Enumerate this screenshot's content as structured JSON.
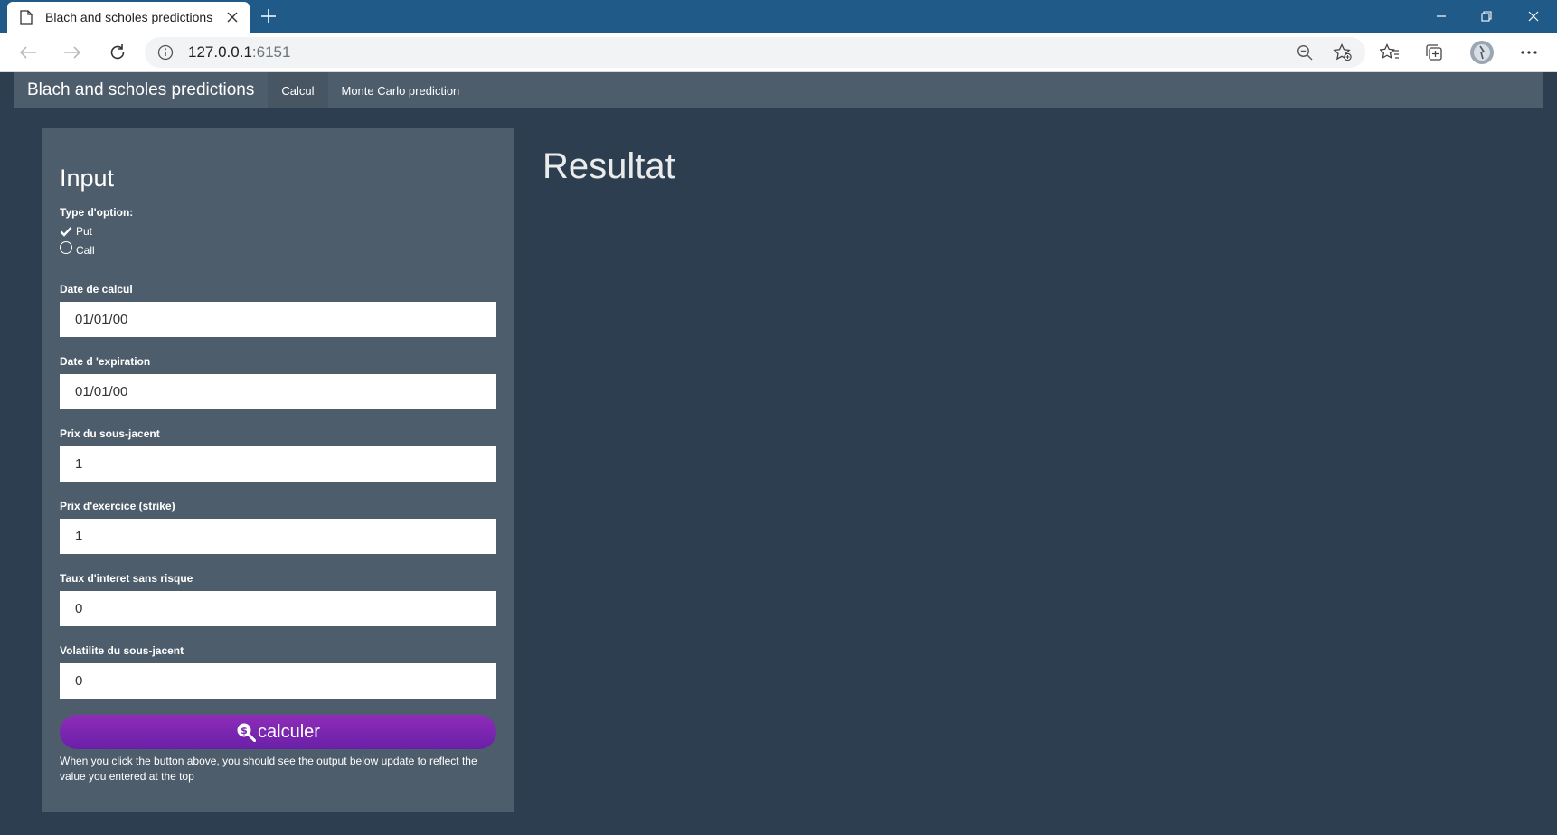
{
  "browser": {
    "tab_title": "Blach and scholes predictions",
    "url_host": "127.0.0.1",
    "url_port": ":6151"
  },
  "navbar": {
    "brand": "Blach and scholes predictions",
    "tabs": [
      {
        "label": "Calcul",
        "active": true
      },
      {
        "label": "Monte Carlo prediction",
        "active": false
      }
    ]
  },
  "sidebar": {
    "title": "Input",
    "option_type": {
      "label": "Type d'option:",
      "options": [
        {
          "label": "Put",
          "selected": true
        },
        {
          "label": "Call",
          "selected": false
        }
      ]
    },
    "fields": [
      {
        "label": "Date de calcul",
        "value": "01/01/00"
      },
      {
        "label": "Date d 'expiration",
        "value": "01/01/00"
      },
      {
        "label": "Prix du sous-jacent",
        "value": "1"
      },
      {
        "label": "Prix d'exercice (strike)",
        "value": "1"
      },
      {
        "label": "Taux d'interet sans risque",
        "value": "0"
      },
      {
        "label": "Volatilite du sous-jacent",
        "value": "0"
      }
    ],
    "button_label": "calculer",
    "help_text": "When you click the button above, you should see the output below update to reflect the value you entered at the top"
  },
  "main": {
    "result_title": "Resultat"
  },
  "colors": {
    "page_bg": "#2c3e50",
    "panel_bg": "#4e5d6c",
    "button_purple": "#7b26b0",
    "browser_chrome": "#1f5a88"
  }
}
